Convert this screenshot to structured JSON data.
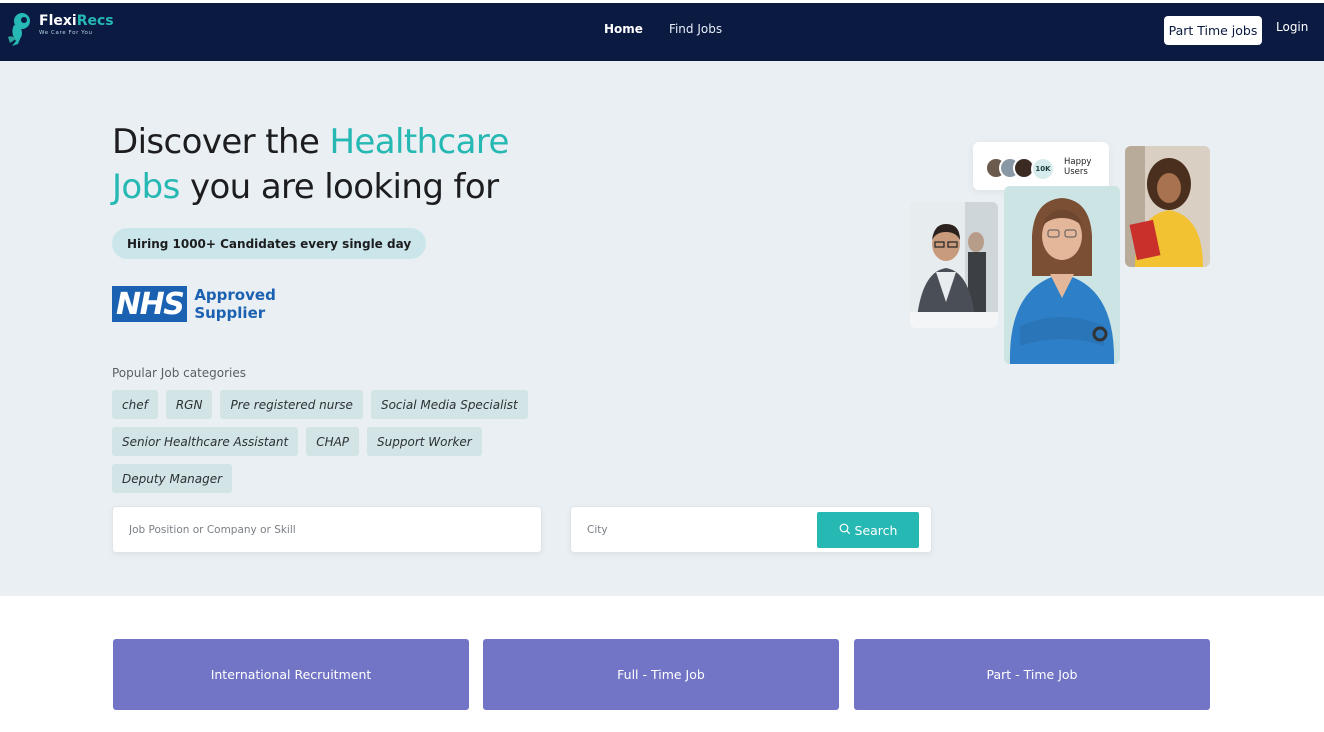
{
  "brand": {
    "name_part1": "Flexi",
    "name_part2": "Recs",
    "tagline": "We Care For You",
    "accent": "#26b8b3",
    "navy": "#0a1a40"
  },
  "nav": {
    "links": [
      "Home",
      "Find Jobs"
    ],
    "part_time_btn": "Part Time jobs",
    "login": "Login"
  },
  "hero": {
    "title_part1": "Discover the ",
    "title_accent1": "Healthcare",
    "title_accent2": "Jobs",
    "title_part2": " you are looking for",
    "pill": "Hiring 1000+ Candidates every single day",
    "nhs_logo": "NHS",
    "nhs_line1": "Approved",
    "nhs_line2": "Supplier",
    "categories_heading": "Popular Job categories",
    "categories": [
      "chef",
      "RGN",
      "Pre registered nurse",
      "Social Media Specialist",
      "Senior Healthcare Assistant",
      "CHAP",
      "Support Worker",
      "Deputy Manager"
    ],
    "happy_count": "10K",
    "happy_line1": "Happy",
    "happy_line2": "Users"
  },
  "search": {
    "position_placeholder": "Job Position or Company or Skill",
    "city_placeholder": "City",
    "button": "Search",
    "icon": "search-icon"
  },
  "cards": [
    "International Recruitment",
    "Full - Time Job",
    "Part - Time Job"
  ],
  "colors": {
    "hero_bg": "#e9eff3",
    "chip_bg": "#d2e4e6",
    "card_bg": "#7274c6",
    "nhs_blue": "#1b61b2"
  }
}
